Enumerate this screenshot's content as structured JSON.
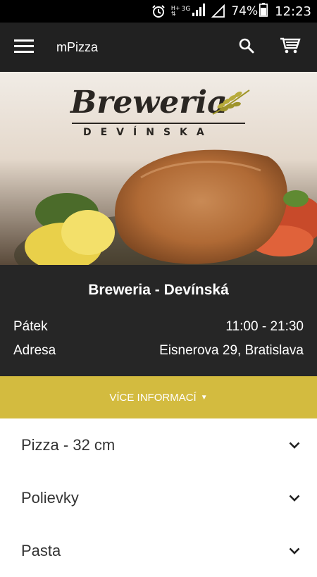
{
  "status_bar": {
    "network_top": "H+",
    "network_sub": "3G",
    "battery": "74%",
    "time": "12:23",
    "icons": [
      "alarm-icon",
      "signal-icon",
      "wifi-empty-icon",
      "battery-icon"
    ]
  },
  "app_bar": {
    "title": "mPizza",
    "icons": [
      "hamburger-menu-icon",
      "search-icon",
      "cart-icon"
    ]
  },
  "hero": {
    "logo_title": "Breweria",
    "logo_subtitle": "DEVÍNSKA"
  },
  "restaurant": {
    "name": "Breweria - Devínská",
    "rows": [
      {
        "label": "Pátek",
        "value": "11:00 - 21:30"
      },
      {
        "label": "Adresa",
        "value": "Eisnerova 29, Bratislava"
      }
    ]
  },
  "more_info": {
    "label": "VÍCE INFORMACÍ",
    "caret": "▼"
  },
  "categories": [
    {
      "label": "Pizza - 32 cm"
    },
    {
      "label": "Polievky"
    },
    {
      "label": "Pasta"
    }
  ],
  "colors": {
    "status_bar": "#000000",
    "app_bar": "#212121",
    "info_panel": "#262626",
    "accent": "#d3bb3f",
    "list_text": "#333333"
  }
}
